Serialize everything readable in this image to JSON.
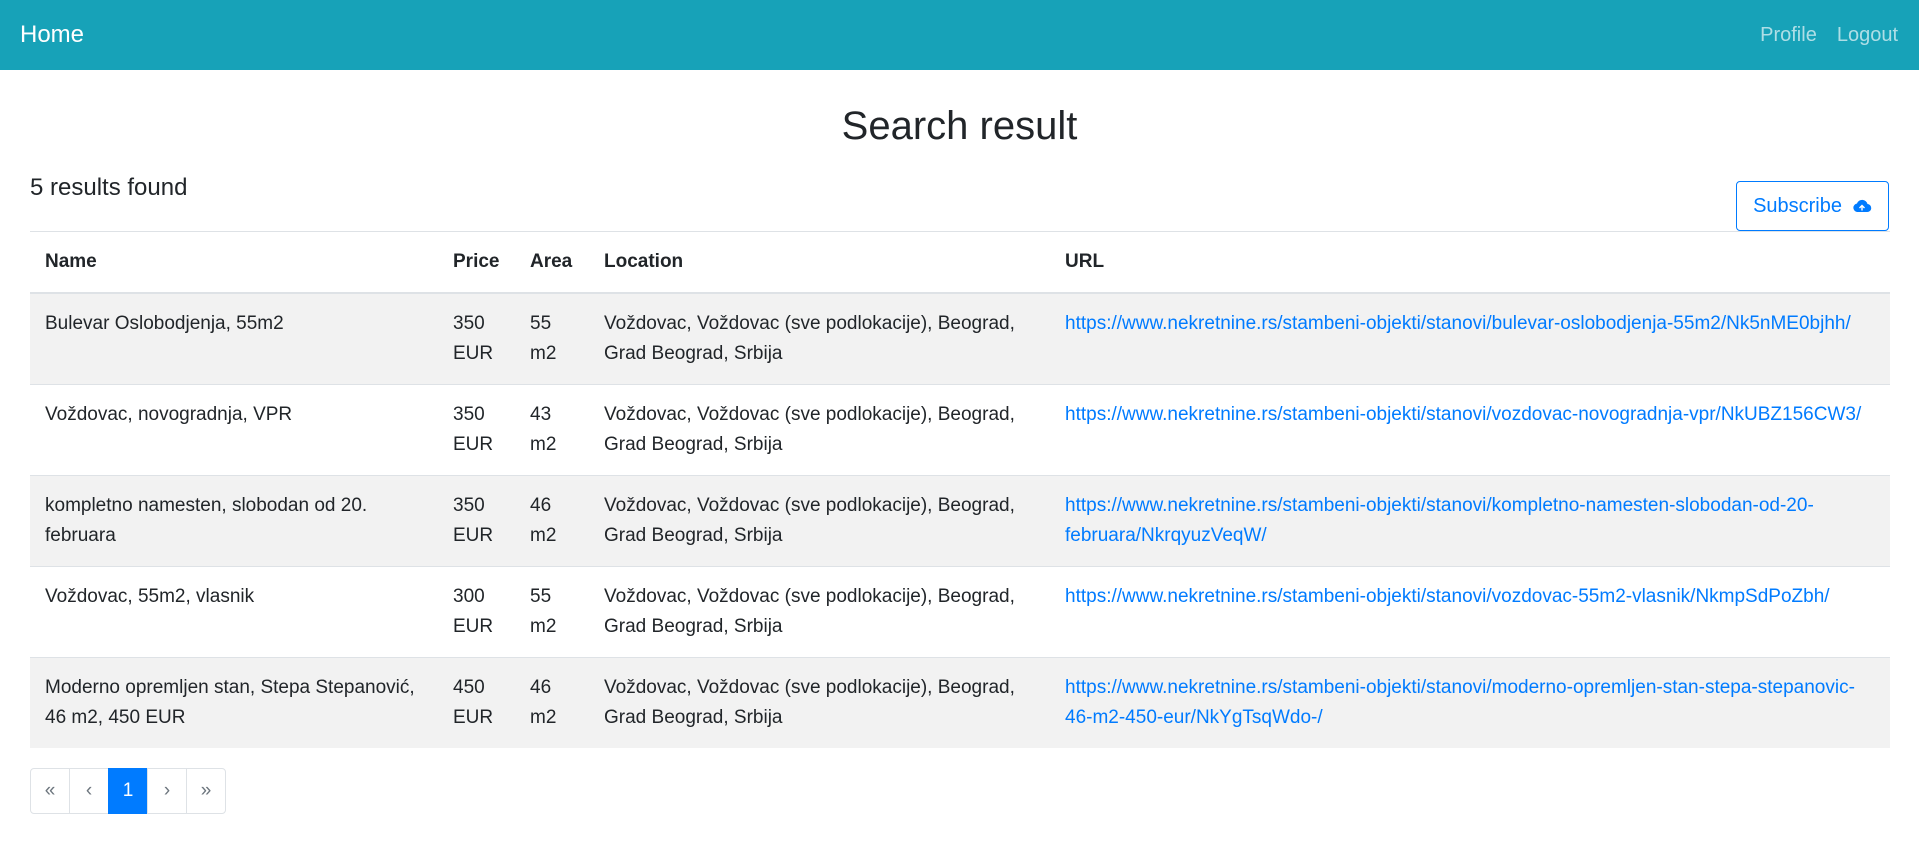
{
  "nav": {
    "brand": "Home",
    "profile": "Profile",
    "logout": "Logout"
  },
  "page": {
    "title": "Search result",
    "count": "5 results found"
  },
  "subscribe": {
    "label": "Subscribe",
    "icon": "cloud-icon"
  },
  "table": {
    "headers": {
      "name": "Name",
      "price": "Price",
      "area": "Area",
      "location": "Location",
      "url": "URL"
    },
    "rows": [
      {
        "name": "Bulevar Oslobodjenja, 55m2",
        "price": "350 EUR",
        "area": "55 m2",
        "location": "Voždovac, Voždovac (sve podlokacije), Beograd, Grad Beograd, Srbija",
        "url": "https://www.nekretnine.rs/stambeni-objekti/stanovi/bulevar-oslobodjenja-55m2/Nk5nME0bjhh/"
      },
      {
        "name": "Voždovac, novogradnja, VPR",
        "price": "350 EUR",
        "area": "43 m2",
        "location": "Voždovac, Voždovac (sve podlokacije), Beograd, Grad Beograd, Srbija",
        "url": "https://www.nekretnine.rs/stambeni-objekti/stanovi/vozdovac-novogradnja-vpr/NkUBZ156CW3/"
      },
      {
        "name": "kompletno namesten, slobodan od 20. februara",
        "price": "350 EUR",
        "area": "46 m2",
        "location": "Voždovac, Voždovac (sve podlokacije), Beograd, Grad Beograd, Srbija",
        "url": "https://www.nekretnine.rs/stambeni-objekti/stanovi/kompletno-namesten-slobodan-od-20-februara/NkrqyuzVeqW/"
      },
      {
        "name": "Voždovac, 55m2, vlasnik",
        "price": "300 EUR",
        "area": "55 m2",
        "location": "Voždovac, Voždovac (sve podlokacije), Beograd, Grad Beograd, Srbija",
        "url": "https://www.nekretnine.rs/stambeni-objekti/stanovi/vozdovac-55m2-vlasnik/NkmpSdPoZbh/"
      },
      {
        "name": "Moderno opremljen stan, Stepa Stepanović, 46 m2, 450 EUR",
        "price": "450 EUR",
        "area": "46 m2",
        "location": "Voždovac, Voždovac (sve podlokacije), Beograd, Grad Beograd, Srbija",
        "url": "https://www.nekretnine.rs/stambeni-objekti/stanovi/moderno-opremljen-stan-stepa-stepanovic-46-m2-450-eur/NkYgTsqWdo-/"
      }
    ]
  },
  "pagination": {
    "first": "«",
    "prev": "‹",
    "current": "1",
    "next": "›",
    "last": "»"
  }
}
